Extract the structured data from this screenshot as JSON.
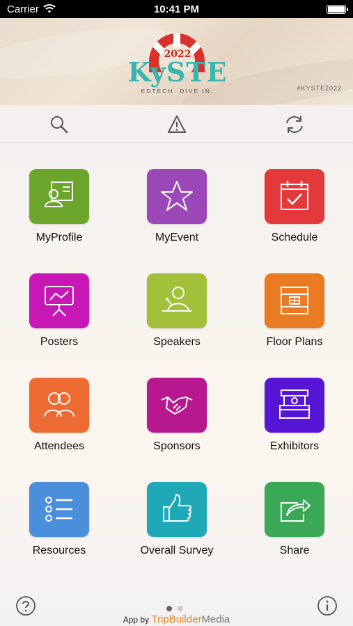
{
  "status_bar": {
    "carrier": "Carrier",
    "time": "10:41 PM"
  },
  "banner": {
    "year": "2022",
    "wordmark": "KySTE",
    "tagline": "EDTECH. DIVE IN.",
    "hashtag": "#KYSTE2022",
    "colors": {
      "red": "#d9322c",
      "teal": "#38b5b1"
    }
  },
  "toolbar": {
    "items": [
      {
        "name": "search",
        "icon": "search-icon"
      },
      {
        "name": "alerts",
        "icon": "warning-icon"
      },
      {
        "name": "refresh",
        "icon": "sync-icon"
      }
    ]
  },
  "tiles": [
    {
      "label": "MyProfile",
      "color": "#6ba52b",
      "icon": "profile-card-icon"
    },
    {
      "label": "MyEvent",
      "color": "#9b47b8",
      "icon": "star-icon"
    },
    {
      "label": "Schedule",
      "color": "#e4393a",
      "icon": "calendar-check-icon"
    },
    {
      "label": "Posters",
      "color": "#c717b5",
      "icon": "presentation-board-icon"
    },
    {
      "label": "Speakers",
      "color": "#a2c03a",
      "icon": "speaker-podium-icon"
    },
    {
      "label": "Floor Plans",
      "color": "#eb7b22",
      "icon": "floor-plan-icon"
    },
    {
      "label": "Attendees",
      "color": "#ee6a33",
      "icon": "people-icon"
    },
    {
      "label": "Sponsors",
      "color": "#b8188f",
      "icon": "handshake-icon"
    },
    {
      "label": "Exhibitors",
      "color": "#5615d4",
      "icon": "booth-icon"
    },
    {
      "label": "Resources",
      "color": "#4a8edc",
      "icon": "list-icon"
    },
    {
      "label": "Overall Survey",
      "color": "#1fa8b5",
      "icon": "thumbs-up-icon"
    },
    {
      "label": "Share",
      "color": "#3aa856",
      "icon": "share-icon"
    }
  ],
  "pagination": {
    "current": 1,
    "total": 2
  },
  "footer": {
    "credit_prefix": "App by",
    "brand_part1": "TripBuilder",
    "brand_part2": "Media"
  }
}
